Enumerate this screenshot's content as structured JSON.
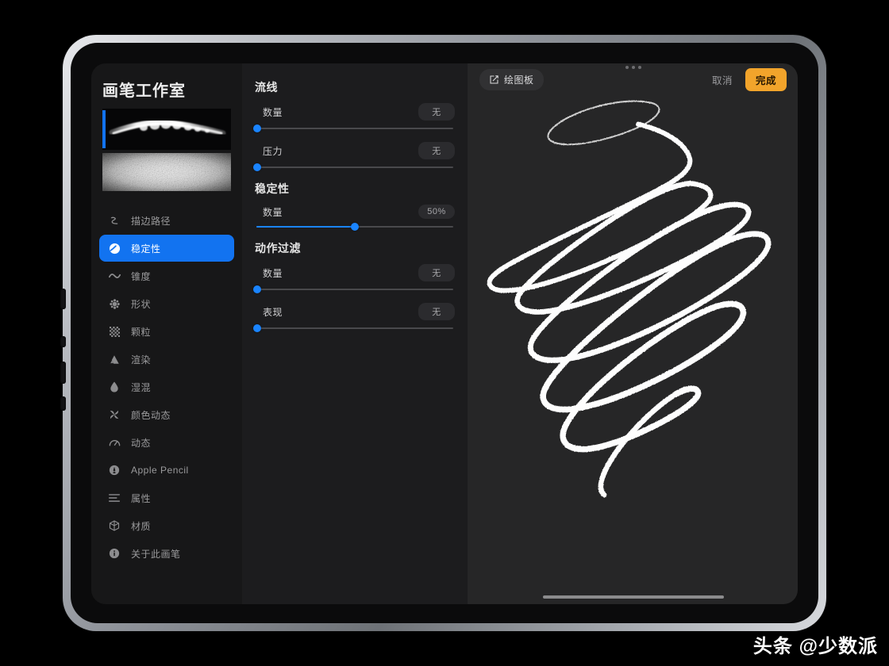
{
  "app": {
    "sidebar_title": "画笔工作室"
  },
  "sidebar": {
    "items": [
      {
        "label": "描边路径",
        "icon": "stroke-path-icon",
        "active": false
      },
      {
        "label": "稳定性",
        "icon": "stabilization-icon",
        "active": true
      },
      {
        "label": "锥度",
        "icon": "taper-wave-icon",
        "active": false
      },
      {
        "label": "形状",
        "icon": "shape-burst-icon",
        "active": false
      },
      {
        "label": "颗粒",
        "icon": "grain-icon",
        "active": false
      },
      {
        "label": "渲染",
        "icon": "render-mountain-icon",
        "active": false
      },
      {
        "label": "湿混",
        "icon": "wet-mix-droplet-icon",
        "active": false
      },
      {
        "label": "颜色动态",
        "icon": "color-dynamics-icon",
        "active": false
      },
      {
        "label": "动态",
        "icon": "dynamics-gauge-icon",
        "active": false
      },
      {
        "label": "Apple Pencil",
        "icon": "apple-pencil-icon",
        "active": false
      },
      {
        "label": "属性",
        "icon": "properties-list-icon",
        "active": false
      },
      {
        "label": "材质",
        "icon": "material-cube-icon",
        "active": false
      },
      {
        "label": "关于此画笔",
        "icon": "info-circle-icon",
        "active": false
      }
    ]
  },
  "settings": {
    "groups": [
      {
        "title": "流线",
        "sliders": [
          {
            "name": "数量",
            "value": "无",
            "percent": 0
          },
          {
            "name": "压力",
            "value": "无",
            "percent": 0
          }
        ]
      },
      {
        "title": "稳定性",
        "sliders": [
          {
            "name": "数量",
            "value": "50%",
            "percent": 50
          }
        ]
      },
      {
        "title": "动作过滤",
        "sliders": [
          {
            "name": "数量",
            "value": "无",
            "percent": 0
          },
          {
            "name": "表现",
            "value": "无",
            "percent": 0
          }
        ]
      }
    ]
  },
  "canvas": {
    "board_chip_label": "绘图板",
    "board_chip_icon": "pencil-square-icon",
    "cancel_label": "取消",
    "done_label": "完成"
  },
  "watermark": {
    "text": "头条 @少数派"
  },
  "colors": {
    "accent_blue": "#1273f0",
    "slider_blue": "#1a84ff",
    "done_orange": "#f2a42b",
    "sidebar_bg": "#171718",
    "settings_bg": "#1c1c1e",
    "canvas_bg": "#262627"
  }
}
